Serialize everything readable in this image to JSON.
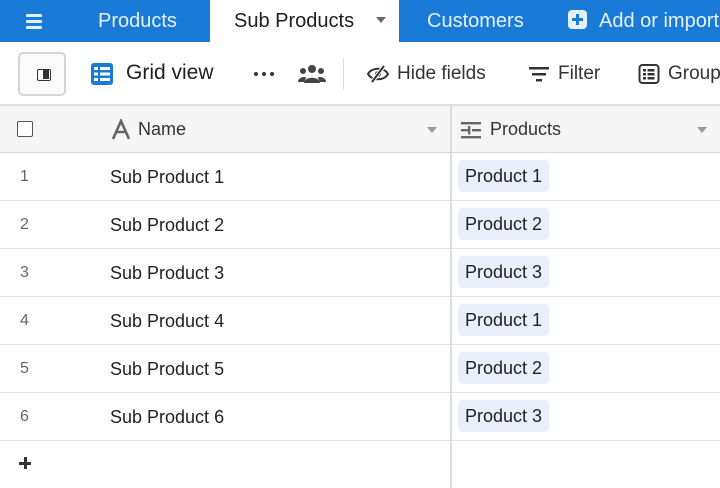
{
  "colors": {
    "tabbar_bg": "#1a7ad7",
    "tab_text": "#e6f0fb",
    "chip_bg": "#e9eefa",
    "header_bg": "#f5f5f5",
    "accent_icon": "#1a7ad7"
  },
  "tabs": {
    "menu_icon": "hamburger-menu-icon",
    "items": [
      {
        "label": "Products",
        "active": false
      },
      {
        "label": "Sub Products",
        "active": true
      },
      {
        "label": "Customers",
        "active": false
      }
    ],
    "add_label": "Add or import",
    "add_icon": "plus-square-icon"
  },
  "toolbar": {
    "sidebar_toggle_icon": "sidebar-toggle-icon",
    "view_icon": "grid-icon",
    "view_name": "Grid view",
    "more_icon": "ellipsis-icon",
    "collaborators_icon": "people-icon",
    "hide_fields_label": "Hide fields",
    "hide_fields_icon": "eye-slash-icon",
    "filter_label": "Filter",
    "filter_icon": "filter-icon",
    "group_label": "Group",
    "group_icon": "group-list-icon"
  },
  "table": {
    "columns": [
      {
        "label": "Name",
        "icon": "text-field-icon"
      },
      {
        "label": "Products",
        "icon": "linked-record-icon"
      }
    ],
    "rows": [
      {
        "num": "1",
        "name": "Sub Product 1",
        "product": "Product 1"
      },
      {
        "num": "2",
        "name": "Sub Product 2",
        "product": "Product 2"
      },
      {
        "num": "3",
        "name": "Sub Product 3",
        "product": "Product 3"
      },
      {
        "num": "4",
        "name": "Sub Product 4",
        "product": "Product 1"
      },
      {
        "num": "5",
        "name": "Sub Product 5",
        "product": "Product 2"
      },
      {
        "num": "6",
        "name": "Sub Product 6",
        "product": "Product 3"
      }
    ],
    "add_row_icon": "plus-icon"
  }
}
